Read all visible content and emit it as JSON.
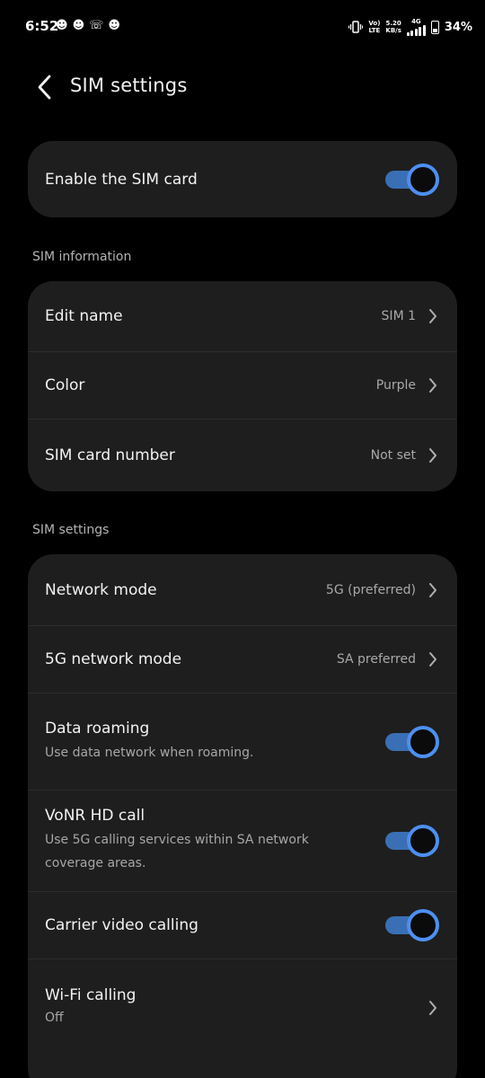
{
  "status_bar": {
    "time": "6:52",
    "left_icons": [
      "snapchat-icon",
      "snapchat-icon",
      "whatsapp-icon",
      "snapchat-icon"
    ],
    "volte_top": "Vo)",
    "volte_bottom": "LTE",
    "speed_top": "5.20",
    "speed_bottom": "KB/s",
    "network_type": "4G",
    "battery": "34%"
  },
  "header": {
    "title": "SIM settings"
  },
  "enable_card": {
    "label": "Enable the SIM card",
    "enabled": true
  },
  "sim_information": {
    "header": "SIM information",
    "items": [
      {
        "label": "Edit name",
        "value": "SIM 1"
      },
      {
        "label": "Color",
        "value": "Purple"
      },
      {
        "label": "SIM card number",
        "value": "Not set"
      }
    ]
  },
  "sim_settings": {
    "header": "SIM settings",
    "items": [
      {
        "label": "Network mode",
        "value": "5G (preferred)"
      },
      {
        "label": "5G network mode",
        "value": "SA preferred"
      },
      {
        "label": "Data roaming",
        "sub": "Use data network when roaming.",
        "enabled": true
      },
      {
        "label": "VoNR HD call",
        "sub": "Use 5G calling services within SA network coverage areas.",
        "enabled": true
      },
      {
        "label": "Carrier video calling",
        "enabled": true
      },
      {
        "label": "Wi-Fi calling",
        "sub": "Off"
      }
    ]
  },
  "colors": {
    "background": "#000000",
    "card": "#1e1e1e",
    "accent": "#4d8ff0",
    "toggle_track": "#3a6fb5"
  }
}
